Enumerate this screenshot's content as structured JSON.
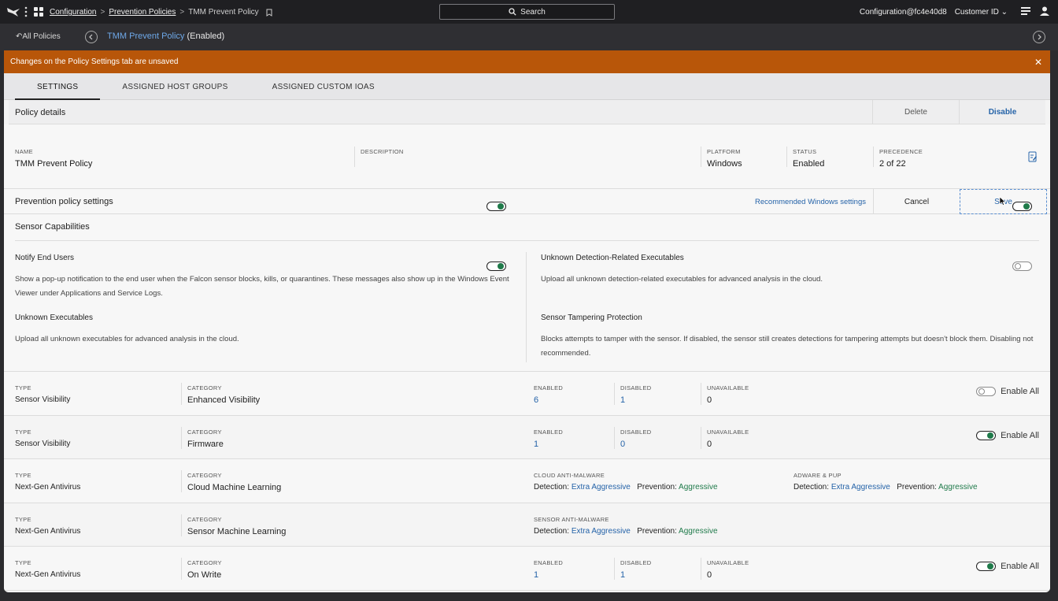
{
  "topbar": {
    "breadcrumbs": [
      "Configuration",
      "Prevention Policies",
      "TMM Prevent Policy"
    ],
    "search_label": "Search",
    "user": "Configuration@fc4e40d8",
    "customer_id": "Customer ID"
  },
  "subbar": {
    "back_label": "All Policies",
    "policy_name": "TMM Prevent Policy",
    "policy_state": "(Enabled)"
  },
  "banner": {
    "message": "Changes on the Policy Settings tab are unsaved"
  },
  "tabs": [
    {
      "label": "SETTINGS",
      "active": true
    },
    {
      "label": "ASSIGNED HOST GROUPS"
    },
    {
      "label": "ASSIGNED CUSTOM IOAS"
    }
  ],
  "policy_details": {
    "title": "Policy details",
    "delete_label": "Delete",
    "disable_label": "Disable",
    "fields": {
      "name_k": "NAME",
      "name_v": "TMM Prevent Policy",
      "desc_k": "DESCRIPTION",
      "desc_v": "",
      "platform_k": "PLATFORM",
      "platform_v": "Windows",
      "status_k": "STATUS",
      "status_v": "Enabled",
      "precedence_k": "PRECEDENCE",
      "precedence_v": "2 of 22"
    }
  },
  "prevention": {
    "title": "Prevention policy settings",
    "recommended_link": "Recommended Windows settings",
    "cancel_label": "Cancel",
    "save_label": "Save"
  },
  "sensor_capabilities": {
    "title": "Sensor Capabilities",
    "items": [
      {
        "title": "Notify End Users",
        "desc": "Show a pop-up notification to the end user when the Falcon sensor blocks, kills, or quarantines. These messages also show up in the Windows Event Viewer under Applications and Service Logs.",
        "enabled": true
      },
      {
        "title": "Unknown Detection-Related Executables",
        "desc": "Upload all unknown detection-related executables for advanced analysis in the cloud.",
        "enabled": true
      },
      {
        "title": "Unknown Executables",
        "desc": "Upload all unknown executables for advanced analysis in the cloud.",
        "enabled": true
      },
      {
        "title": "Sensor Tampering Protection",
        "desc": "Blocks attempts to tamper with the sensor. If disabled, the sensor still creates detections for tampering attempts but doesn't block them. Disabling not recommended.",
        "enabled": false
      }
    ]
  },
  "labels": {
    "type": "TYPE",
    "category": "CATEGORY",
    "enabled": "ENABLED",
    "disabled": "DISABLED",
    "unavailable": "UNAVAILABLE",
    "enable_all": "Enable All",
    "detection": "Detection:",
    "prevention": "Prevention:"
  },
  "rows": [
    {
      "type": "Sensor Visibility",
      "category": "Enhanced Visibility",
      "enabled": "6",
      "disabled": "1",
      "unavailable": "0",
      "enable_all": false
    },
    {
      "type": "Sensor Visibility",
      "category": "Firmware",
      "enabled": "1",
      "disabled": "0",
      "unavailable": "0",
      "enable_all": true
    },
    {
      "type": "Next-Gen Antivirus",
      "category": "Cloud Machine Learning",
      "group1": "CLOUD ANTI-MALWARE",
      "g1_detection": "Extra Aggressive",
      "g1_prevention": "Aggressive",
      "group2": "ADWARE & PUP",
      "g2_detection": "Extra Aggressive",
      "g2_prevention": "Aggressive"
    },
    {
      "type": "Next-Gen Antivirus",
      "category": "Sensor Machine Learning",
      "group1": "SENSOR ANTI-MALWARE",
      "g1_detection": "Extra Aggressive",
      "g1_prevention": "Aggressive"
    },
    {
      "type": "Next-Gen Antivirus",
      "category": "On Write",
      "enabled": "1",
      "disabled": "1",
      "unavailable": "0",
      "enable_all": true
    }
  ],
  "colors": {
    "banner": "#b85609",
    "link": "#2563a8",
    "green": "#1f7a4a"
  }
}
